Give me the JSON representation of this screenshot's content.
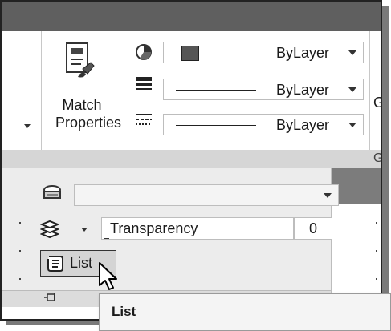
{
  "match_properties": {
    "line1": "Match",
    "line2": "Properties"
  },
  "color_combo": {
    "value": "ByLayer",
    "swatch": "#555555"
  },
  "linetype_combo": {
    "value": "ByLayer"
  },
  "lineweight_combo": {
    "value": "ByLayer"
  },
  "right_cut_letters": {
    "g1": "G",
    "g2": "G"
  },
  "expanded": {
    "plot_style_value": "",
    "transparency_label": "Transparency",
    "transparency_value": "0",
    "list_button_label": "List"
  },
  "tooltip": {
    "text": "List"
  },
  "icons": [
    "match-properties-brush-icon",
    "color-wheel-icon",
    "lineweight-icon",
    "linetype-icon",
    "plot-style-printer-icon",
    "transparency-layers-icon",
    "list-scroll-icon",
    "pin-icon",
    "mouse-cursor-icon"
  ]
}
